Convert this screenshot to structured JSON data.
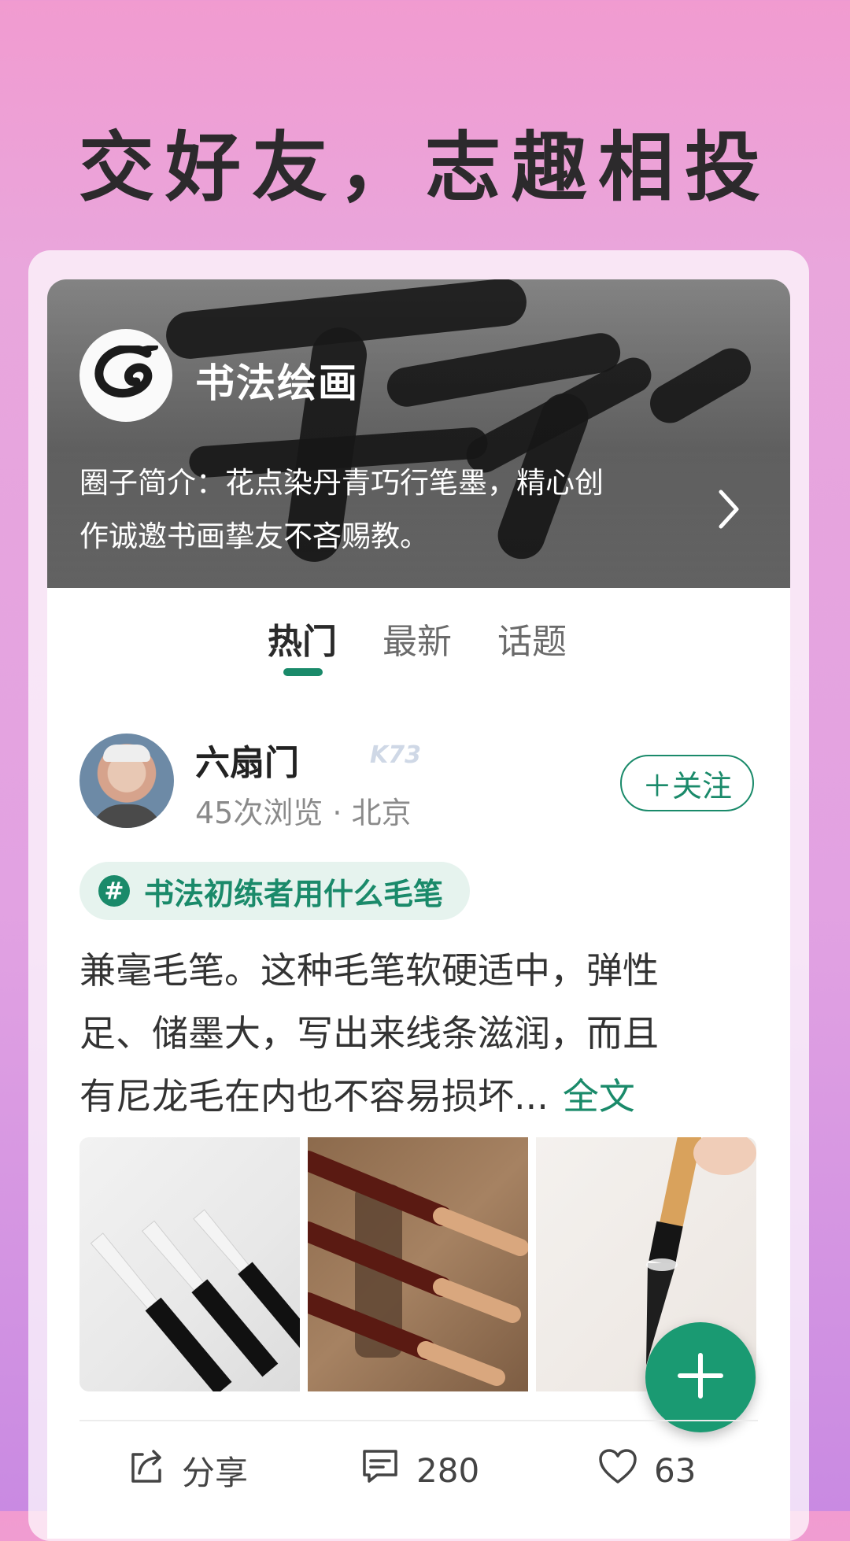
{
  "promo": {
    "headline": "交好友，志趣相投"
  },
  "circle": {
    "name": "书法绘画",
    "intro_line1": "圈子简介：花点染丹青巧行笔墨，精心创",
    "intro_line2": "作诚邀书画挚友不吝赐教。",
    "logo_icon": "ink-swirl-icon",
    "more_icon": "chevron-right-icon"
  },
  "tabs": [
    {
      "label": "热门",
      "active": true
    },
    {
      "label": "最新",
      "active": false
    },
    {
      "label": "话题",
      "active": false
    }
  ],
  "post": {
    "author": {
      "name": "六扇门",
      "meta": "45次浏览 · 北京"
    },
    "follow_label": "＋关注",
    "topic": {
      "icon_glyph": "#",
      "label": "书法初练者用什么毛笔"
    },
    "body_lines": [
      "兼毫毛笔。这种毛笔软硬适中，弹性",
      "足、储墨大，写出来线条滋润，而且",
      "有尼龙毛在内也不容易损坏..."
    ],
    "read_more": "全文",
    "images": [
      "brush-set-white",
      "brush-rest-wood",
      "brush-writing"
    ],
    "actions": {
      "share_label": "分享",
      "comment_count": "280",
      "like_count": "63"
    }
  },
  "watermark": "K73",
  "colors": {
    "accent_green": "#1a8a6a",
    "background_pink": "#f19bd0",
    "background_purple": "#c98ae2"
  }
}
